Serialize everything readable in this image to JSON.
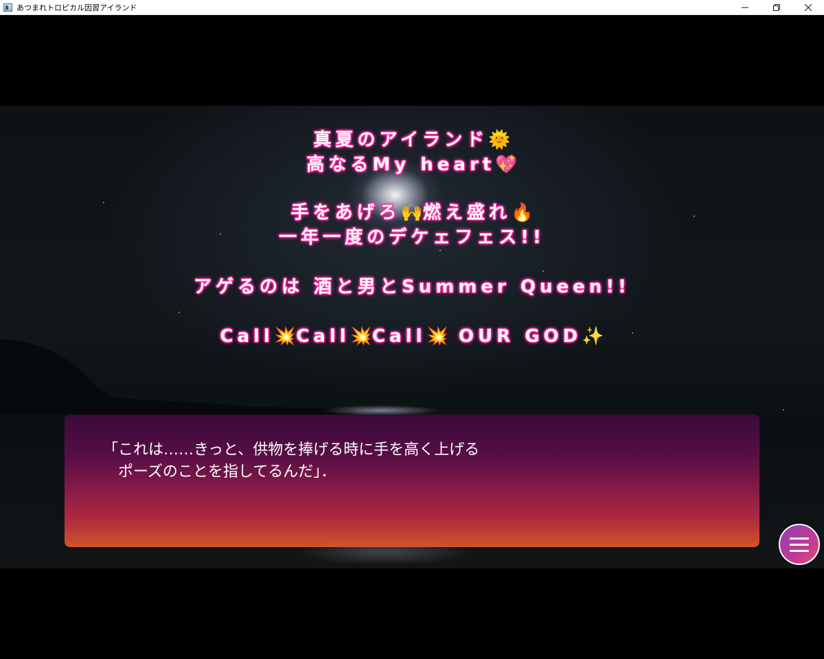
{
  "window": {
    "title": "あつまれトロピカル因習アイランド",
    "controls": [
      "minimize-icon",
      "restore-icon",
      "close-icon"
    ]
  },
  "lyrics": {
    "lines": [
      {
        "text": "真夏のアイランド",
        "emoji": "🌞"
      },
      {
        "text": "高なるMy heart",
        "emoji": "💖"
      },
      {
        "text": "手をあげろ",
        "emoji": "🙌",
        "text2": "燃え盛れ",
        "emoji2": "🔥"
      },
      {
        "text": "一年一度のデケェフェス!!"
      },
      {
        "text": "アゲるのは 酒と男とSummer Queen!!"
      },
      {
        "parts": [
          "Call",
          "💥",
          "Call",
          "💥",
          "Call",
          "💥",
          " OUR GOD",
          "✨"
        ]
      }
    ]
  },
  "message": {
    "line1": "「これは……きっと、供物を捧げる時に手を高く上げる",
    "line2": "　ポーズのことを指してるんだ」．"
  },
  "menu": {
    "icon": "hamburger-menu-icon"
  },
  "colors": {
    "lyric_glow": "#ff2fa6",
    "message_top": "#3a0a3c",
    "message_bottom": "#d9582a"
  }
}
